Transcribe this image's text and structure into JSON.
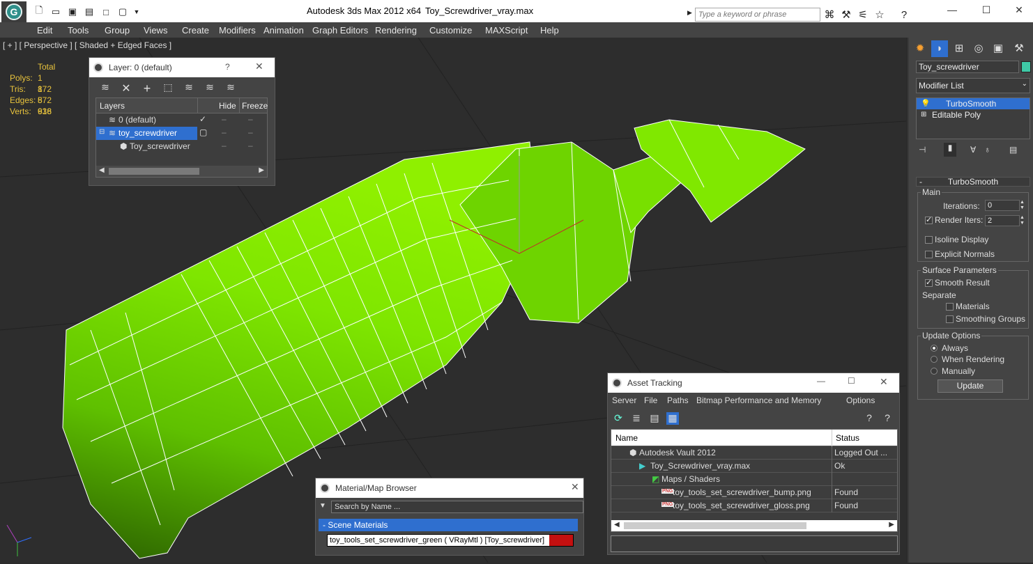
{
  "titlebar": {
    "app": "Autodesk 3ds Max  2012 x64",
    "file": "Toy_Screwdriver_vray.max",
    "search_placeholder": "Type a keyword or phrase"
  },
  "menu": [
    "Edit",
    "Tools",
    "Group",
    "Views",
    "Create",
    "Modifiers",
    "Animation",
    "Graph Editors",
    "Rendering",
    "Customize",
    "MAXScript",
    "Help"
  ],
  "viewport": {
    "label": "[ + ] [ Perspective ] [ Shaded + Edged Faces ]",
    "stats": {
      "header": "Total",
      "rows": [
        {
          "label": "Polys:",
          "value": "1 872"
        },
        {
          "label": "Tris:",
          "value": "1 872"
        },
        {
          "label": "Edges:",
          "value": "5 616"
        },
        {
          "label": "Verts:",
          "value": "938"
        }
      ]
    },
    "model_color": "#7fe000"
  },
  "layer_dialog": {
    "title": "Layer: 0 (default)",
    "help": "?",
    "columns": [
      "Layers",
      "Hide",
      "Freeze"
    ],
    "rows": [
      {
        "name": "0 (default)"
      },
      {
        "name": "toy_screwdriver"
      },
      {
        "name": "Toy_screwdriver"
      }
    ]
  },
  "asset_dialog": {
    "title": "Asset Tracking",
    "menu": [
      "Server",
      "File",
      "Paths",
      "Bitmap Performance and Memory",
      "Options"
    ],
    "columns": [
      "Name",
      "Status"
    ],
    "rows": [
      {
        "name": "Autodesk Vault 2012",
        "status": "Logged Out ..."
      },
      {
        "name": "Toy_Screwdriver_vray.max",
        "status": "Ok"
      },
      {
        "name": "Maps / Shaders",
        "status": ""
      },
      {
        "name": "toy_tools_set_screwdriver_bump.png",
        "status": "Found"
      },
      {
        "name": "toy_tools_set_screwdriver_gloss.png",
        "status": "Found"
      }
    ]
  },
  "material_dialog": {
    "title": "Material/Map Browser",
    "search_placeholder": "Search by Name ...",
    "group": "- Scene Materials",
    "item": "toy_tools_set_screwdriver_green  ( VRayMtl ) [Toy_screwdriver]"
  },
  "command_panel": {
    "object_name": "Toy_screwdriver",
    "modifier_list": "Modifier List",
    "stack": [
      "TurboSmooth",
      "Editable Poly"
    ],
    "rollout_title": "TurboSmooth",
    "main": {
      "title": "Main",
      "iterations_label": "Iterations:",
      "iterations": "0",
      "render_iters_label": "Render Iters:",
      "render_iters": "2",
      "isoline": "Isoline Display",
      "explicit": "Explicit Normals"
    },
    "surface": {
      "title": "Surface Parameters",
      "smooth_result": "Smooth Result",
      "separate": "Separate",
      "materials": "Materials",
      "smoothing_groups": "Smoothing Groups"
    },
    "update": {
      "title": "Update Options",
      "always": "Always",
      "when_rendering": "When Rendering",
      "manually": "Manually",
      "button": "Update"
    }
  }
}
